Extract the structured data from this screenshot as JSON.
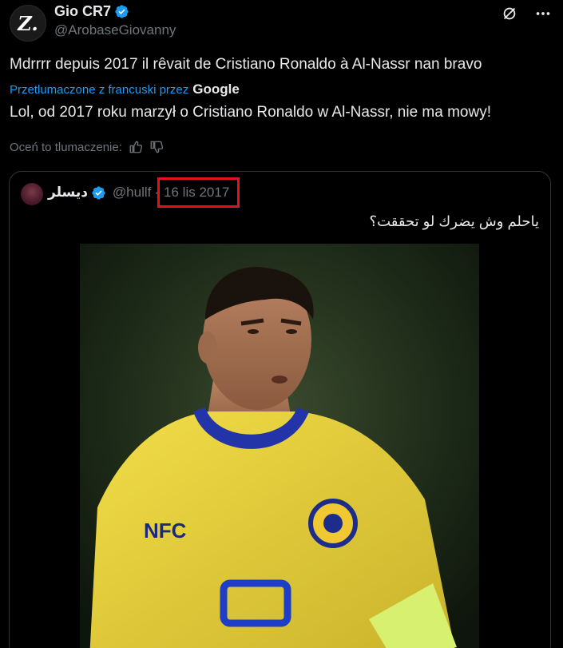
{
  "author": {
    "display_name": "Gio CR7",
    "handle": "@ArobaseGiovanny",
    "avatar_letter": "Z."
  },
  "tweet": {
    "text": "Mdrrrr depuis 2017 il rêvait de Cristiano Ronaldo à Al-Nassr nan bravo",
    "translated_by": "Przetlumaczone z francuski przez",
    "translator": "Google",
    "translation": "Lol, od 2017 roku marzył o Cristiano Ronaldo w Al-Nassr, nie ma mowy!",
    "rate_label": "Oceń to tlumaczenie:"
  },
  "quote": {
    "display_name": "ديسلر",
    "handle": "@hullf",
    "separator": "·",
    "date": "16 lis 2017",
    "text": "ياحلم وش يضرك لو تحققت؟",
    "jersey_text": "NFC"
  },
  "colors": {
    "accent": "#1d9bf0",
    "highlight": "#e5121b",
    "jersey": "#e8d13a"
  }
}
